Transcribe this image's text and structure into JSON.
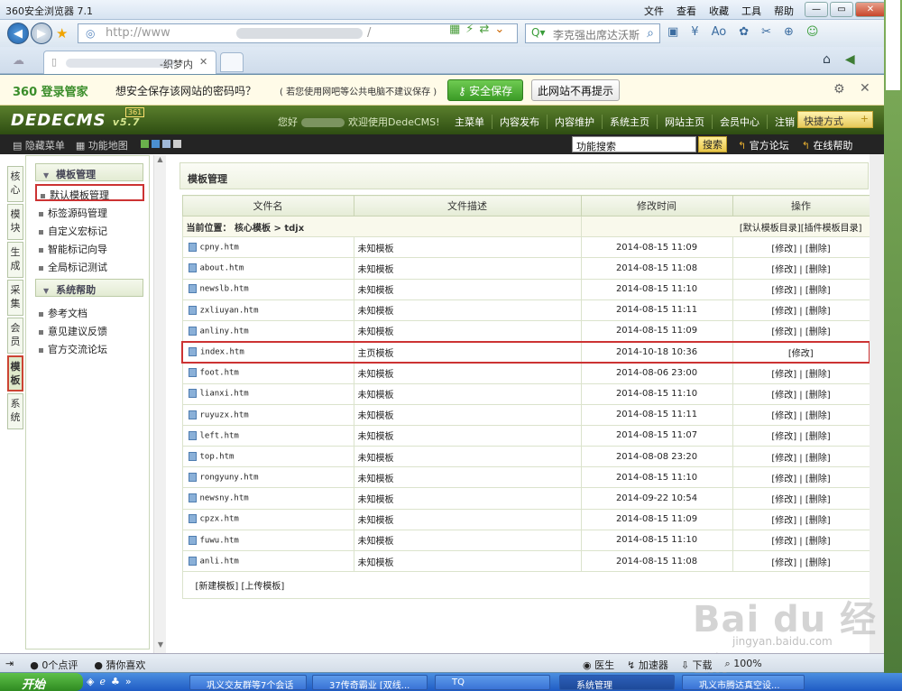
{
  "browser": {
    "title": "360安全浏览器 7.1",
    "menus": [
      "文件",
      "查看",
      "收藏",
      "工具",
      "帮助"
    ],
    "url": "http://www",
    "url_suffix": "/",
    "search_text": "李克强出席达沃斯",
    "tab_title": "-织梦内",
    "status_left": [
      "0个点评",
      "猜你喜欢"
    ],
    "status_right": [
      "医生",
      "加速器",
      "下载",
      "100%"
    ]
  },
  "pwbar": {
    "logo": "360 登录管家",
    "question": "想安全保存该网站的密码吗？",
    "note": "( 若您使用网吧等公共电脑不建议保存 )",
    "save": "安全保存",
    "noprompt": "此网站不再提示"
  },
  "cms": {
    "logo": "DEDECMS",
    "version": "v5.7",
    "hello": "您好",
    "welcome": "欢迎使用DedeCMS!",
    "topnav": [
      "主菜单",
      "内容发布",
      "内容维护",
      "系统主页",
      "网站主页",
      "会员中心",
      "注销"
    ],
    "shortcut": "快捷方式",
    "sub_left": [
      "隐藏菜单",
      "功能地图"
    ],
    "search_value": "功能搜索",
    "search_btn": "搜索",
    "sub_right": [
      "官方论坛",
      "在线帮助"
    ]
  },
  "sidetabs": [
    "核心",
    "模块",
    "生成",
    "采集",
    "会员",
    "模板",
    "系统"
  ],
  "leftmenu": {
    "section1": "模板管理",
    "items1": [
      "默认模板管理",
      "标签源码管理",
      "自定义宏标记",
      "智能标记向导",
      "全局标记测试"
    ],
    "section2": "系统帮助",
    "items2": [
      "参考文档",
      "意见建议反馈",
      "官方交流论坛"
    ]
  },
  "main": {
    "title": "模板管理",
    "headers": [
      "文件名",
      "文件描述",
      "修改时间",
      "操作"
    ],
    "location_label": "当前位置：",
    "location_path": "核心模板 > tdjx",
    "location_links": "[默认模板目录][插件模板目录]",
    "rows": [
      {
        "file": "cpny.htm",
        "desc": "未知模板",
        "time": "2014-08-15 11:09",
        "ops": "[修改] | [删除]"
      },
      {
        "file": "about.htm",
        "desc": "未知模板",
        "time": "2014-08-15 11:08",
        "ops": "[修改] | [删除]"
      },
      {
        "file": "newslb.htm",
        "desc": "未知模板",
        "time": "2014-08-15 11:10",
        "ops": "[修改] | [删除]"
      },
      {
        "file": "zxliuyan.htm",
        "desc": "未知模板",
        "time": "2014-08-15 11:11",
        "ops": "[修改] | [删除]"
      },
      {
        "file": "anliny.htm",
        "desc": "未知模板",
        "time": "2014-08-15 11:09",
        "ops": "[修改] | [删除]"
      },
      {
        "file": "index.htm",
        "desc": "主页模板",
        "time": "2014-10-18 10:36",
        "ops": "[修改]"
      },
      {
        "file": "foot.htm",
        "desc": "未知模板",
        "time": "2014-08-06 23:00",
        "ops": "[修改] | [删除]"
      },
      {
        "file": "lianxi.htm",
        "desc": "未知模板",
        "time": "2014-08-15 11:10",
        "ops": "[修改] | [删除]"
      },
      {
        "file": "ruyuzx.htm",
        "desc": "未知模板",
        "time": "2014-08-15 11:11",
        "ops": "[修改] | [删除]"
      },
      {
        "file": "left.htm",
        "desc": "未知模板",
        "time": "2014-08-15 11:07",
        "ops": "[修改] | [删除]"
      },
      {
        "file": "top.htm",
        "desc": "未知模板",
        "time": "2014-08-08 23:20",
        "ops": "[修改] | [删除]"
      },
      {
        "file": "rongyuny.htm",
        "desc": "未知模板",
        "time": "2014-08-15 11:10",
        "ops": "[修改] | [删除]"
      },
      {
        "file": "newsny.htm",
        "desc": "未知模板",
        "time": "2014-09-22 10:54",
        "ops": "[修改] | [删除]"
      },
      {
        "file": "cpzx.htm",
        "desc": "未知模板",
        "time": "2014-08-15 11:09",
        "ops": "[修改] | [删除]"
      },
      {
        "file": "fuwu.htm",
        "desc": "未知模板",
        "time": "2014-08-15 11:10",
        "ops": "[修改] | [删除]"
      },
      {
        "file": "anli.htm",
        "desc": "未知模板",
        "time": "2014-08-15 11:08",
        "ops": "[修改] | [删除]"
      }
    ],
    "footer": "[新建模板]  [上传模板]"
  },
  "taskbar": {
    "start": "开始",
    "tasks": [
      "巩义交友群等7个会话",
      "37传奇霸业 [双线...",
      "TQ",
      "系统管理",
      "巩义市腾达真空设..."
    ]
  },
  "watermark": "Bai du 经验",
  "watermark_url": "jingyan.baidu.com",
  "colors": {
    "accent": "#3a8d2a",
    "highlight": "#cc3333",
    "header_bg": "#2e4d12"
  }
}
